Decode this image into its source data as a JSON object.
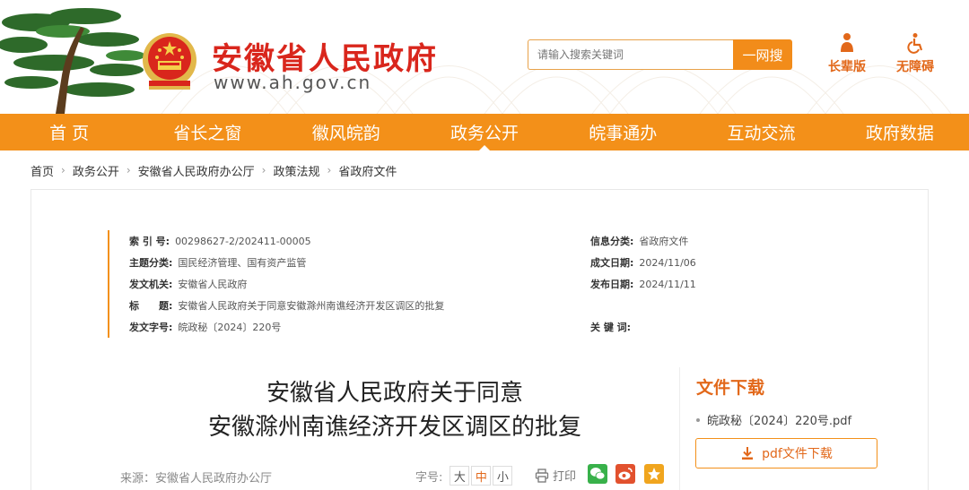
{
  "header": {
    "site_title": "安徽省人民政府",
    "site_url": "www.ah.gov.cn",
    "search_placeholder": "请输入搜索关键词",
    "search_button": "一网搜",
    "tool_elder": "长辈版",
    "tool_access": "无障碍"
  },
  "nav": {
    "items": [
      "首 页",
      "省长之窗",
      "徽风皖韵",
      "政务公开",
      "皖事通办",
      "互动交流",
      "政府数据"
    ],
    "active": "政务公开"
  },
  "breadcrumb": [
    "首页",
    "政务公开",
    "安徽省人民政府办公厅",
    "政策法规",
    "省政府文件"
  ],
  "meta": {
    "index_label": "索 引 号:",
    "index_value": "00298627-2/202411-00005",
    "topic_label": "主题分类:",
    "topic_value": "国民经济管理、国有资产监管",
    "issuer_label": "发文机关:",
    "issuer_value": "安徽省人民政府",
    "title_label": "标　　题:",
    "title_value": "安徽省人民政府关于同意安徽滁州南谯经济开发区调区的批复",
    "docno_label": "发文字号:",
    "docno_value": "皖政秘〔2024〕220号",
    "category_label": "信息分类:",
    "category_value": "省政府文件",
    "created_label": "成文日期:",
    "created_value": "2024/11/06",
    "published_label": "发布日期:",
    "published_value": "2024/11/11",
    "keywords_label": "关 键 词:",
    "keywords_value": ""
  },
  "document": {
    "title_line1": "安徽省人民政府关于同意",
    "title_line2": "安徽滁州南谯经济开发区调区的批复",
    "source": "来源：安徽省人民政府办公厅",
    "font_label": "字号:",
    "font_large": "大",
    "font_medium": "中",
    "font_small": "小",
    "print_label": "打印"
  },
  "download": {
    "title": "文件下载",
    "file_name": "皖政秘〔2024〕220号.pdf",
    "button_label": "pdf文件下载"
  },
  "colors": {
    "brand_orange": "#f39019",
    "title_red": "#d9261c",
    "accent_text": "#e2681a"
  }
}
